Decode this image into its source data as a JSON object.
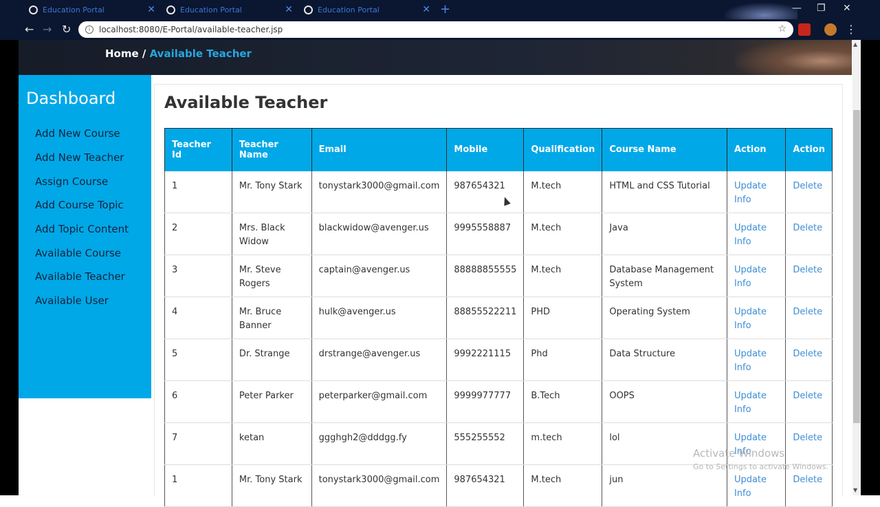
{
  "browser": {
    "tabs": [
      {
        "title": "Education Portal"
      },
      {
        "title": "Education Portal"
      },
      {
        "title": "Education Portal"
      }
    ],
    "url": "localhost:8080/E-Portal/available-teacher.jsp",
    "window_controls": {
      "minimize": "—",
      "maximize": "❐",
      "close": "✕"
    }
  },
  "breadcrumb": {
    "home": "Home /",
    "current": "Available Teacher"
  },
  "sidebar": {
    "title": "Dashboard",
    "items": [
      {
        "label": "Add New Course"
      },
      {
        "label": "Add New Teacher"
      },
      {
        "label": "Assign Course"
      },
      {
        "label": "Add Course Topic"
      },
      {
        "label": "Add Topic Content"
      },
      {
        "label": "Available Course"
      },
      {
        "label": "Available Teacher"
      },
      {
        "label": "Available User"
      }
    ]
  },
  "main": {
    "title": "Available Teacher",
    "columns": [
      "Teacher Id",
      "Teacher Name",
      "Email",
      "Mobile",
      "Qualification",
      "Course Name",
      "Action",
      "Action"
    ],
    "rows": [
      {
        "id": "1",
        "name": "Mr. Tony Stark",
        "email": "tonystark3000@gmail.com",
        "mobile": "987654321",
        "qual": "M.tech",
        "course": "HTML and CSS Tutorial",
        "update": "Update Info",
        "delete": "Delete"
      },
      {
        "id": "2",
        "name": "Mrs. Black Widow",
        "email": "blackwidow@avenger.us",
        "mobile": "9995558887",
        "qual": "M.tech",
        "course": "Java",
        "update": "Update Info",
        "delete": "Delete"
      },
      {
        "id": "3",
        "name": "Mr. Steve Rogers",
        "email": "captain@avenger.us",
        "mobile": "88888855555",
        "qual": "M.tech",
        "course": "Database Management System",
        "update": "Update Info",
        "delete": "Delete"
      },
      {
        "id": "4",
        "name": "Mr. Bruce Banner",
        "email": "hulk@avenger.us",
        "mobile": "88855522211",
        "qual": "PHD",
        "course": "Operating System",
        "update": "Update Info",
        "delete": "Delete"
      },
      {
        "id": "5",
        "name": "Dr. Strange",
        "email": "drstrange@avenger.us",
        "mobile": "9992221115",
        "qual": "Phd",
        "course": "Data Structure",
        "update": "Update Info",
        "delete": "Delete"
      },
      {
        "id": "6",
        "name": "Peter Parker",
        "email": "peterparker@gmail.com",
        "mobile": "9999977777",
        "qual": "B.Tech",
        "course": "OOPS",
        "update": "Update Info",
        "delete": "Delete"
      },
      {
        "id": "7",
        "name": "ketan",
        "email": "ggghgh2@dddgg.fy",
        "mobile": "555255552",
        "qual": "m.tech",
        "course": "lol",
        "update": "Update Info",
        "delete": "Delete"
      },
      {
        "id": "1",
        "name": "Mr. Tony Stark",
        "email": "tonystark3000@gmail.com",
        "mobile": "987654321",
        "qual": "M.tech",
        "course": "jun",
        "update": "Update Info",
        "delete": "Delete"
      }
    ]
  },
  "watermark": {
    "line1": "Activate Windows",
    "line2": "Go to Settings to activate Windows."
  },
  "colors": {
    "accent": "#00a8e8",
    "link": "#3d8ed6",
    "chrome": "#0b1630"
  }
}
